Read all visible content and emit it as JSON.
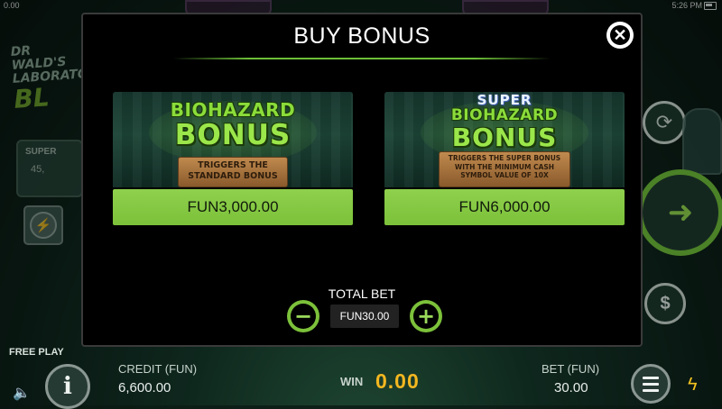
{
  "status_bar": {
    "left_value": "0.00",
    "time": "5:26 PM"
  },
  "background": {
    "logo_line1": "DR WALD'S",
    "logo_line2": "LABORATORY",
    "logo_line3": "BL",
    "panel_label": "SUPER",
    "panel_value": "45,"
  },
  "modal": {
    "title": "BUY BONUS",
    "close_icon": "close-icon",
    "cards": [
      {
        "super_label": "",
        "title_line1": "BIOHAZARD",
        "title_line2": "BONUS",
        "description": "TRIGGERS THE STANDARD BONUS",
        "price": "FUN3,000.00"
      },
      {
        "super_label": "SUPER",
        "title_line1": "BIOHAZARD",
        "title_line2": "BONUS",
        "description": "TRIGGERS THE SUPER BONUS WITH THE MINIMUM CASH SYMBOL VALUE OF 10X",
        "price": "FUN6,000.00"
      }
    ],
    "total_bet_label": "TOTAL BET",
    "total_bet_value": "FUN30.00",
    "minus_symbol": "−",
    "plus_symbol": "+"
  },
  "bottom_bar": {
    "free_play": "FREE PLAY",
    "credit_label": "CREDIT (FUN)",
    "credit_value": "6,600.00",
    "win_label": "WIN",
    "win_value": "0.00",
    "bet_label": "BET (FUN)",
    "bet_value": "30.00",
    "info_symbol": "i"
  },
  "colors": {
    "accent_green": "#7cc13a",
    "win_gold": "#f3b720",
    "modal_bg": "#000000"
  }
}
